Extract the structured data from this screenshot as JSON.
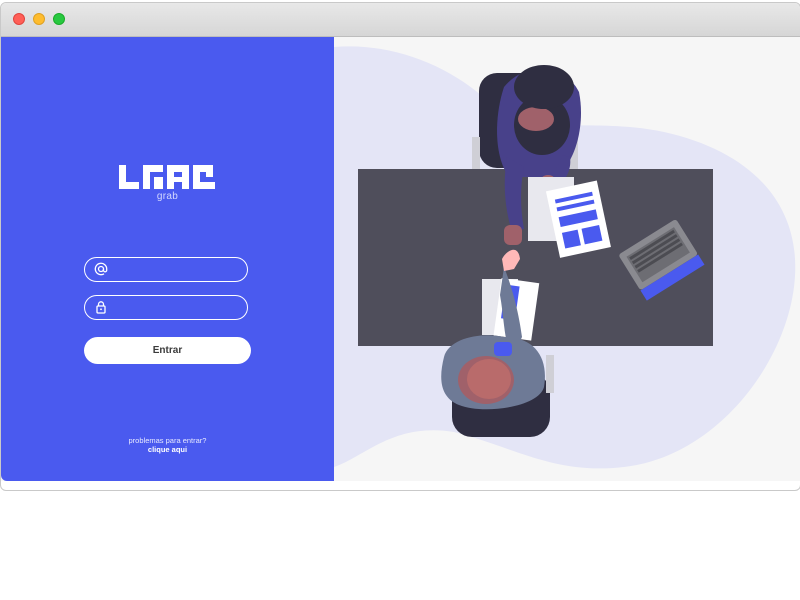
{
  "window": {
    "controls": [
      "close",
      "minimize",
      "maximize"
    ]
  },
  "brand": {
    "logo_text": "grab",
    "color": "#4a5aef"
  },
  "login": {
    "email_icon": "at-icon",
    "email_value": "",
    "password_icon": "lock-icon",
    "password_value": "",
    "submit_label": "Entrar",
    "help_text": "problemas para entrar?",
    "help_link": "clique aqui"
  },
  "illustration": {
    "description_icon": "handshake-meeting-illustration"
  }
}
